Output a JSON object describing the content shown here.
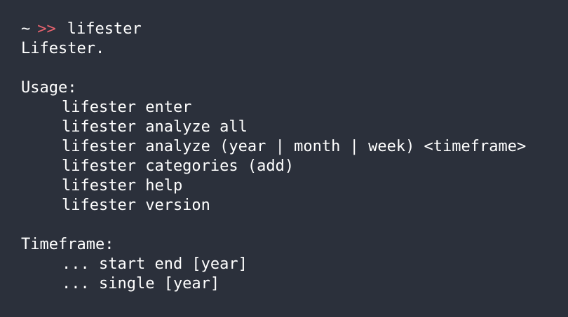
{
  "colors": {
    "background": "#2b303b",
    "text": "#ffffff",
    "prompt_arrow": "#e8636f"
  },
  "prompt": {
    "tilde": "~",
    "arrow": ">>",
    "command": "lifester"
  },
  "output": {
    "title": "Lifester.",
    "usage_header": "Usage:",
    "usage_lines": [
      "lifester enter",
      "lifester analyze all",
      "lifester analyze (year | month | week) <timeframe>",
      "lifester categories (add)",
      "lifester help",
      "lifester version"
    ],
    "timeframe_header": "Timeframe:",
    "timeframe_lines": [
      "... start end [year]",
      "... single [year]"
    ]
  }
}
